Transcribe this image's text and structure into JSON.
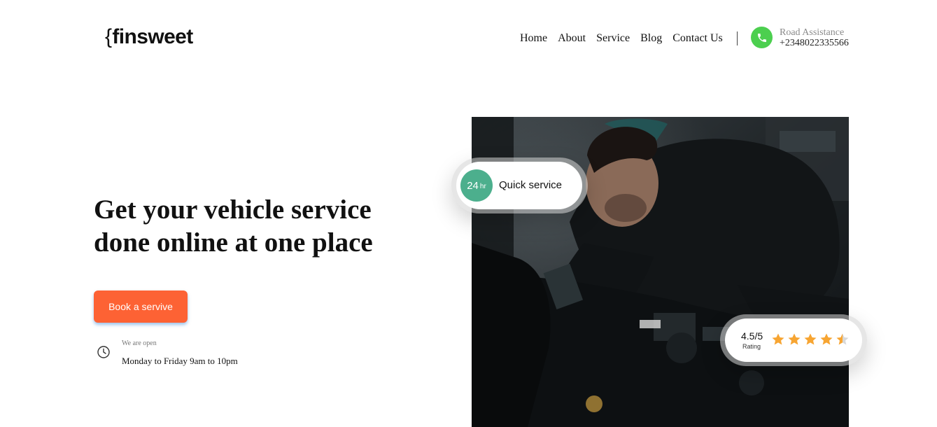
{
  "brand": {
    "logo_text": "finsweet"
  },
  "nav": {
    "items": [
      {
        "label": "Home"
      },
      {
        "label": "About"
      },
      {
        "label": "Service"
      },
      {
        "label": "Blog"
      },
      {
        "label": "Contact Us"
      }
    ]
  },
  "contact": {
    "label": "Road Assistance",
    "phone": "+2348022335566",
    "icon": "phone-icon",
    "icon_color": "#4ccf4f"
  },
  "hero": {
    "title": "Get your vehicle service done online at one place",
    "cta_label": "Book a servive",
    "cta_color": "#fd6234",
    "open_label": "We are open",
    "open_hours": "Monday to Friday 9am to 10pm",
    "clock_icon": "clock-icon"
  },
  "badges": {
    "quick": {
      "number": "24",
      "unit": "hr",
      "label": "Quick service",
      "badge_color": "#4caf8d"
    },
    "rating": {
      "value": "4.5/5",
      "label": "Rating",
      "stars": 4.5,
      "max_stars": 5,
      "star_color": "#f7a532"
    }
  },
  "photo": {
    "icon": "mechanic-photo"
  }
}
